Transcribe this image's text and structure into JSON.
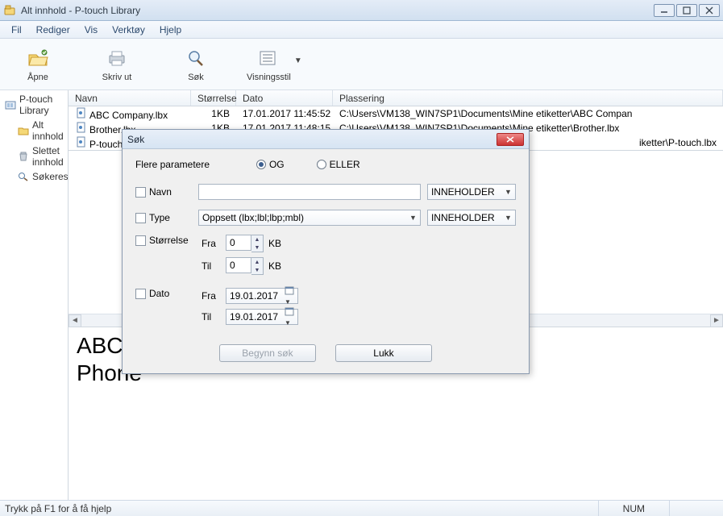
{
  "window": {
    "title": "Alt innhold - P-touch Library"
  },
  "menu": {
    "file": "Fil",
    "edit": "Rediger",
    "view": "Vis",
    "tools": "Verktøy",
    "help": "Hjelp"
  },
  "toolbar": {
    "open": "Åpne",
    "print": "Skriv ut",
    "search": "Søk",
    "viewstyle": "Visningsstil"
  },
  "tree": {
    "root": "P-touch Library",
    "all": "Alt innhold",
    "deleted": "Slettet innhold",
    "results": "Søkeresultater"
  },
  "columns": {
    "name": "Navn",
    "size": "Størrelse",
    "date": "Dato",
    "location": "Plassering"
  },
  "rows": [
    {
      "name": "ABC Company.lbx",
      "size": "1KB",
      "date": "17.01.2017 11:45:52",
      "location": "C:\\Users\\VM138_WIN7SP1\\Documents\\Mine etiketter\\ABC Compan"
    },
    {
      "name": "Brother.lbx",
      "size": "1KB",
      "date": "17.01.2017 11:48:15",
      "location": "C:\\Users\\VM138_WIN7SP1\\Documents\\Mine etiketter\\Brother.lbx"
    },
    {
      "name": "P-touch.",
      "size": "",
      "date": "",
      "location": "iketter\\P-touch.lbx"
    }
  ],
  "preview": {
    "text": "ABC \nPhone"
  },
  "status": {
    "help": "Trykk på F1 for å få hjelp",
    "num": "NUM"
  },
  "dialog": {
    "title": "Søk",
    "more_params": "Flere parametere",
    "and": "OG",
    "or": "ELLER",
    "name": "Navn",
    "type": "Type",
    "size": "Størrelse",
    "date": "Dato",
    "from": "Fra",
    "to": "Til",
    "kb": "KB",
    "contains": "INNEHOLDER",
    "type_value": "Oppsett (lbx;lbl;lbp;mbl)",
    "size_from": "0",
    "size_to": "0",
    "date_from": "19.01.2017",
    "date_to": "19.01.2017",
    "begin": "Begynn søk",
    "close": "Lukk"
  }
}
